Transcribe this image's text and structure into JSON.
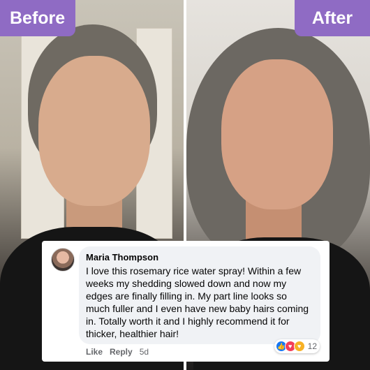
{
  "labels": {
    "before": "Before",
    "after": "After"
  },
  "comment": {
    "author": "Maria Thompson",
    "text": "I love this rosemary rice water spray! Within a few weeks my shedding slowed down and now my edges are finally filling in. My part line looks so much fuller and I even have new baby hairs coming in. Totally worth it and I highly recommend it for thicker, healthier hair!",
    "like_label": "Like",
    "reply_label": "Reply",
    "time": "5d",
    "reaction_count": "12",
    "reactions": [
      "like-icon",
      "love-icon",
      "care-icon"
    ]
  },
  "colors": {
    "badge": "#8f6bc4",
    "bubble": "#f0f2f5",
    "like": "#1877f2",
    "love": "#f33e58",
    "care": "#f7b125"
  }
}
